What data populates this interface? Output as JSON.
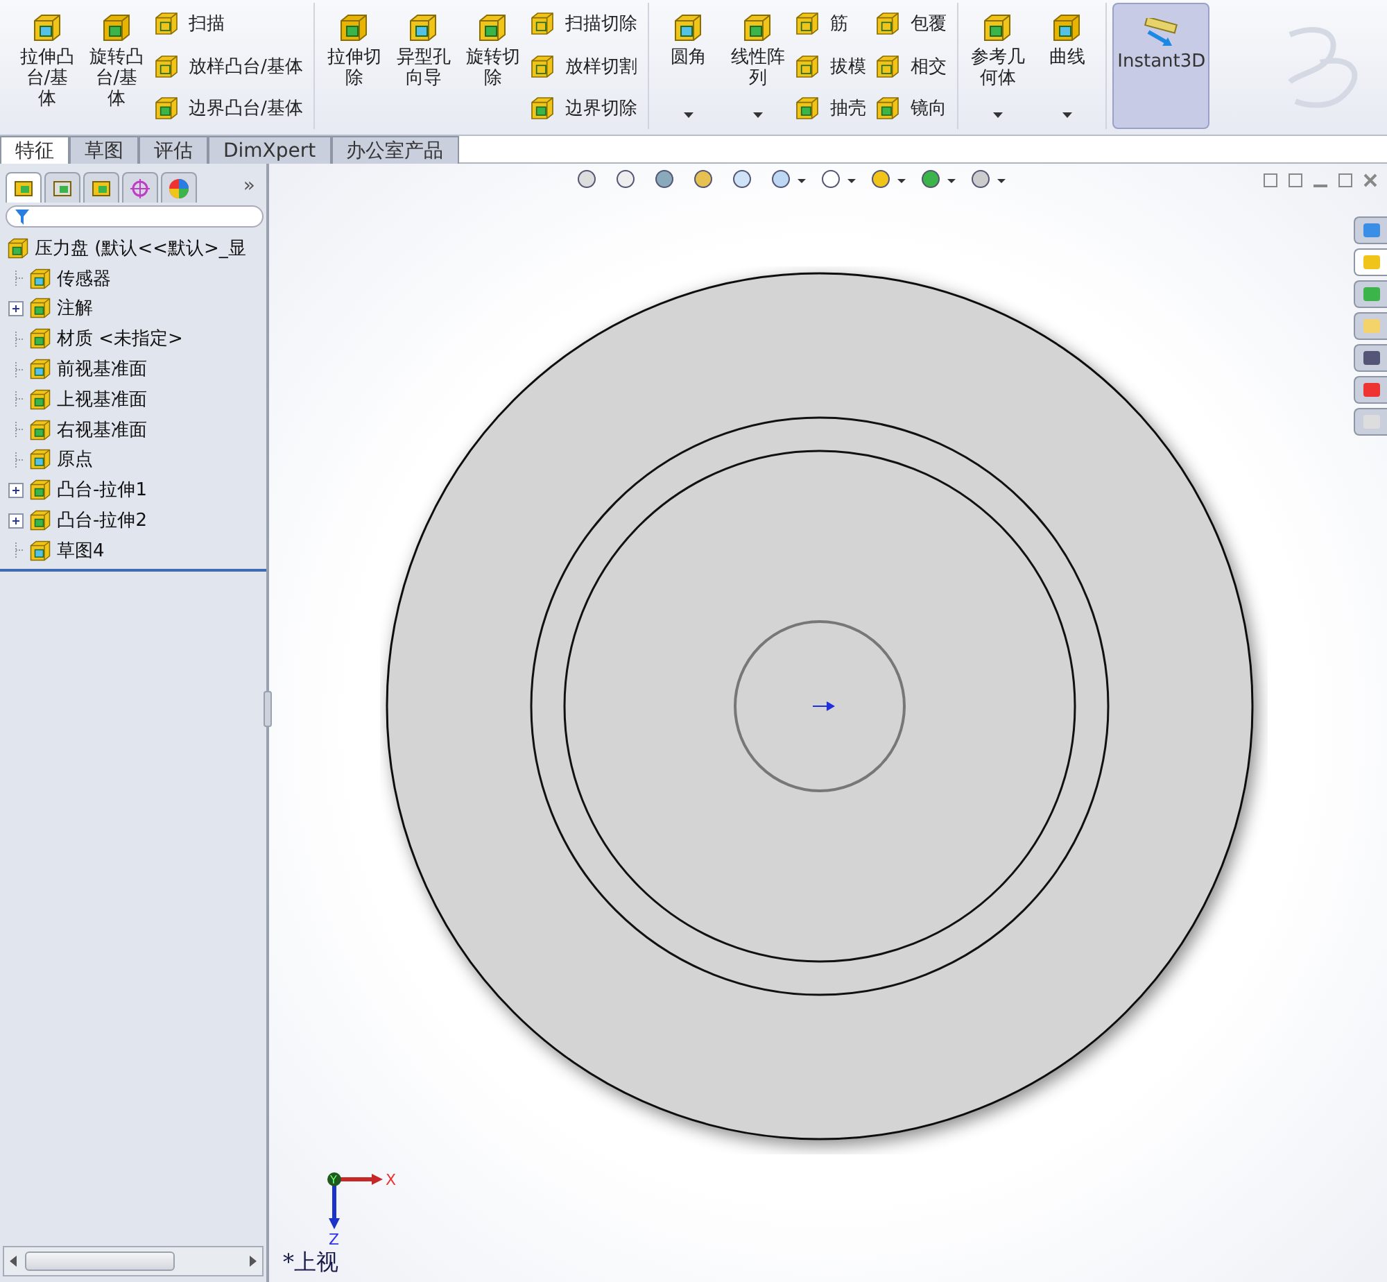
{
  "ribbon": {
    "groups": [
      {
        "columns": [
          {
            "kind": "large",
            "label": "拉伸凸台/基体",
            "dropdown": false
          },
          {
            "kind": "large",
            "label": "旋转凸台/基体",
            "dropdown": false
          },
          {
            "kind": "stack",
            "buttons": [
              "扫描",
              "放样凸台/基体",
              "边界凸台/基体"
            ]
          }
        ]
      },
      {
        "columns": [
          {
            "kind": "large",
            "label": "拉伸切除",
            "dropdown": false
          },
          {
            "kind": "large",
            "label": "异型孔向导",
            "dropdown": false
          },
          {
            "kind": "large",
            "label": "旋转切除",
            "dropdown": false
          },
          {
            "kind": "stack",
            "buttons": [
              "扫描切除",
              "放样切割",
              "边界切除"
            ]
          }
        ]
      },
      {
        "columns": [
          {
            "kind": "large",
            "label": "圆角",
            "dropdown": true
          },
          {
            "kind": "large",
            "label": "线性阵列",
            "dropdown": true
          },
          {
            "kind": "stack",
            "buttons": [
              "筋",
              "拔模",
              "抽壳"
            ]
          },
          {
            "kind": "stack",
            "buttons": [
              "包覆",
              "相交",
              "镜向"
            ]
          }
        ]
      },
      {
        "columns": [
          {
            "kind": "large",
            "label": "参考几何体",
            "dropdown": true
          },
          {
            "kind": "large",
            "label": "曲线",
            "dropdown": true
          }
        ]
      }
    ],
    "toggle": {
      "label": "Instant3D",
      "selected": true
    }
  },
  "tabs": [
    {
      "label": "特征",
      "selected": true
    },
    {
      "label": "草图",
      "selected": false
    },
    {
      "label": "评估",
      "selected": false
    },
    {
      "label": "DimXpert",
      "selected": false
    },
    {
      "label": "办公室产品",
      "selected": false
    }
  ],
  "panel": {
    "tabs": [
      {
        "selected": true
      },
      {
        "selected": false
      },
      {
        "selected": false
      },
      {
        "selected": false
      },
      {
        "selected": false
      }
    ],
    "more": "»",
    "tree": {
      "label": "压力盘  (默认<<默认>_显",
      "children": [
        {
          "label": "传感器",
          "collapsed": false
        },
        {
          "label": "注解",
          "collapsed": true
        },
        {
          "label": "材质 <未指定>",
          "collapsed": false
        },
        {
          "label": "前视基准面",
          "collapsed": false
        },
        {
          "label": "上视基准面",
          "collapsed": false
        },
        {
          "label": "右视基准面",
          "collapsed": false
        },
        {
          "label": "原点",
          "collapsed": false
        },
        {
          "label": "凸台-拉伸1",
          "collapsed": true
        },
        {
          "label": "凸台-拉伸2",
          "collapsed": true
        },
        {
          "label": "草图4",
          "collapsed": false
        }
      ]
    }
  },
  "viewport": {
    "task_pane_tabs": [
      {
        "selected": false
      },
      {
        "selected": true
      },
      {
        "selected": false
      },
      {
        "selected": false
      },
      {
        "selected": false
      },
      {
        "selected": false
      },
      {
        "selected": false
      }
    ],
    "triad": {
      "x": "X",
      "y": "Y",
      "z": "Z"
    },
    "view_name": "*上视"
  }
}
